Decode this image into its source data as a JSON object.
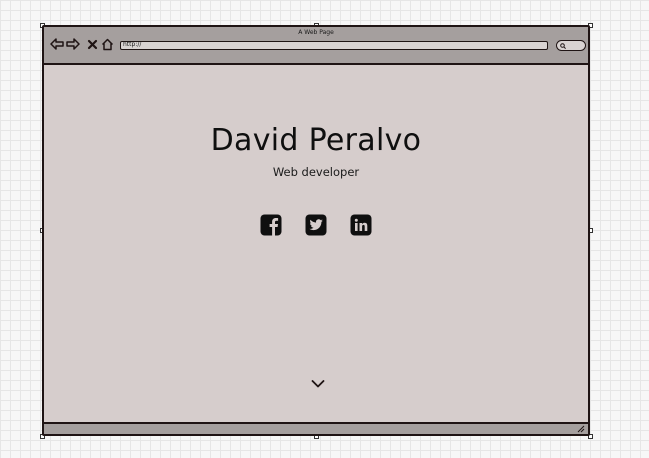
{
  "window": {
    "title": "A Web Page",
    "address": "http://"
  },
  "toolbar": {
    "back_icon": "arrow-left-icon",
    "forward_icon": "arrow-right-icon",
    "stop_icon": "close-icon",
    "home_icon": "home-icon",
    "search_icon": "search-icon"
  },
  "hero": {
    "name": "David Peralvo",
    "role": "Web developer"
  },
  "social": [
    {
      "network": "Facebook",
      "icon": "facebook-icon"
    },
    {
      "network": "Twitter",
      "icon": "twitter-icon"
    },
    {
      "network": "LinkedIn",
      "icon": "linkedin-icon"
    }
  ],
  "scroll_icon": "chevron-down-icon",
  "colors": {
    "frame": "#1f1414",
    "chrome": "#a59f9e",
    "page_background": "#d6cdcc",
    "canvas_background": "#f7f7f7"
  }
}
